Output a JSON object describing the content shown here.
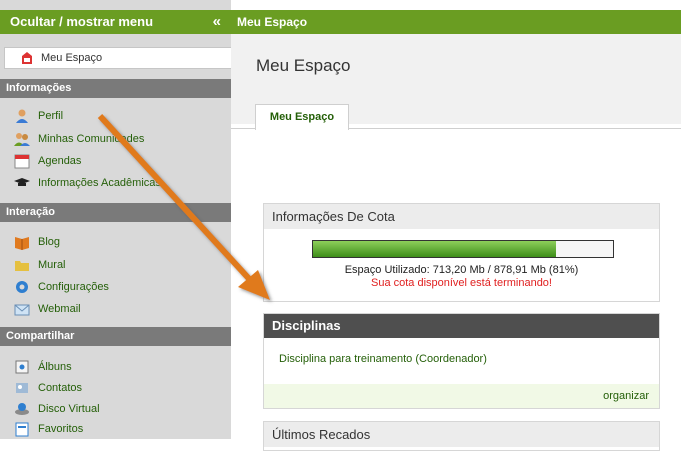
{
  "sidebar": {
    "toggle_label": "Ocultar / mostrar menu",
    "toggle_chevron": "«",
    "my_space": "Meu Espaço",
    "sections": [
      {
        "title": "Informações",
        "items": [
          "Perfil",
          "Minhas Comunidades",
          "Agendas",
          "Informações Acadêmicas"
        ]
      },
      {
        "title": "Interação",
        "items": [
          "Blog",
          "Mural",
          "Configurações",
          "Webmail"
        ]
      },
      {
        "title": "Compartilhar",
        "items": [
          "Álbuns",
          "Contatos",
          "Disco Virtual",
          "Favoritos"
        ]
      }
    ]
  },
  "topbar": {
    "title": "Meu Espaço"
  },
  "main": {
    "page_title": "Meu Espaço",
    "tab_label": "Meu Espaço",
    "quota": {
      "title": "Informações De Cota",
      "used_text": "Espaço Utilizado: 713,20 Mb / 878,91 Mb (81%)",
      "warning": "Sua cota disponível está terminando!",
      "fraction": 0.81
    },
    "disciplinas": {
      "title": "Disciplinas",
      "row": "Disciplina para treinamento   (Coordenador)",
      "organize": "organizar"
    },
    "recados": {
      "title": "Últimos Recados"
    }
  },
  "colors": {
    "brand_green": "#6a9d22",
    "link_green": "#245f08",
    "arrow_orange": "#e07a1f"
  }
}
